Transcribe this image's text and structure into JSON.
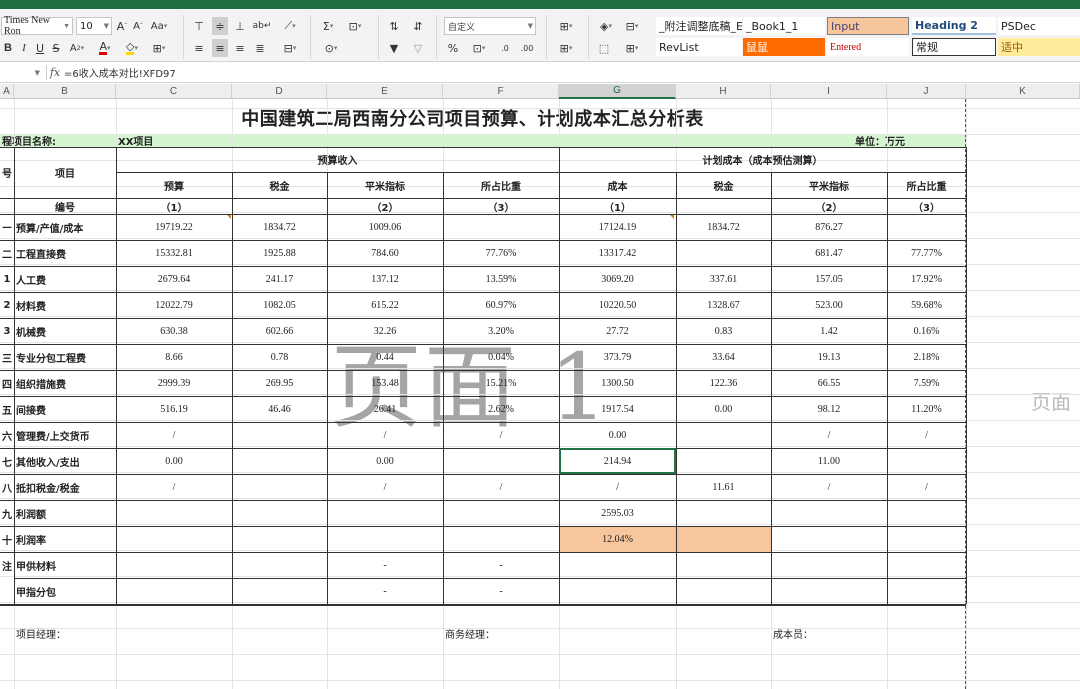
{
  "ribbon": {
    "font_name": "Times New Ron",
    "font_size": "10",
    "number_format": "自定义",
    "styles": [
      {
        "label": "_附注调整底稿_E",
        "bg": "#ffffff",
        "color": "#222222"
      },
      {
        "label": "_Book1_1",
        "bg": "#ffffff",
        "color": "#222222"
      },
      {
        "label": "Input",
        "bg": "#f6c59b",
        "color": "#3f3f76"
      },
      {
        "label": "Heading 2",
        "bg": "#ffffff",
        "color": "#1f497d"
      },
      {
        "label": "PSDec",
        "bg": "#ffffff",
        "color": "#222222"
      },
      {
        "label": "RevList",
        "bg": "#ffffff",
        "color": "#222222"
      },
      {
        "label": "鼠鼠",
        "bg": "#ff6a00",
        "color": "#ffffff"
      },
      {
        "label": "Entered",
        "bg": "#ffffff",
        "color": "#c00000"
      },
      {
        "label": "常规",
        "bg": "#ffffff",
        "color": "#222222"
      },
      {
        "label": "适中",
        "bg": "#ffeb9c",
        "color": "#9c5700"
      }
    ]
  },
  "formula_bar": {
    "fx": "fx",
    "formula": "=6收入成本对比!XFD97"
  },
  "columns": [
    "A",
    "B",
    "C",
    "D",
    "E",
    "F",
    "G",
    "H",
    "I",
    "J",
    "K"
  ],
  "sheet": {
    "title": "中国建筑二局西南分公司项目预算、计划成本汇总分析表",
    "project_label": "程项目名称:",
    "project_value": "XX项目",
    "unit_label": "单位：万元",
    "header_no": "号",
    "header_item": "项目",
    "header_budget": "预算收入",
    "header_plan": "计划成本（成本预估测算）",
    "sub_budget": [
      "预算",
      "税金",
      "平米指标",
      "所占比重"
    ],
    "sub_plan": [
      "成本",
      "税金",
      "平米指标",
      "所占比重"
    ],
    "code_label": "编号",
    "codes": [
      "（1）",
      "",
      "（2）",
      "（3）",
      "（1）",
      "",
      "（2）",
      "（3）"
    ],
    "rows": [
      {
        "no": "—",
        "item": "预算/产值/成本",
        "v": [
          "19719.22",
          "1834.72",
          "1009.06",
          "",
          "17124.19",
          "1834.72",
          "876.27",
          ""
        ]
      },
      {
        "no": "二",
        "item": "工程直接费",
        "v": [
          "15332.81",
          "1925.88",
          "784.60",
          "77.76%",
          "13317.42",
          "",
          "681.47",
          "77.77%"
        ]
      },
      {
        "no": "1",
        "item": "人工费",
        "v": [
          "2679.64",
          "241.17",
          "137.12",
          "13.59%",
          "3069.20",
          "337.61",
          "157.05",
          "17.92%"
        ]
      },
      {
        "no": "2",
        "item": "材料费",
        "v": [
          "12022.79",
          "1082.05",
          "615.22",
          "60.97%",
          "10220.50",
          "1328.67",
          "523.00",
          "59.68%"
        ]
      },
      {
        "no": "3",
        "item": "机械费",
        "v": [
          "630.38",
          "602.66",
          "32.26",
          "3.20%",
          "27.72",
          "0.83",
          "1.42",
          "0.16%"
        ]
      },
      {
        "no": "三",
        "item": "专业分包工程费",
        "v": [
          "8.66",
          "0.78",
          "0.44",
          "0.04%",
          "373.79",
          "33.64",
          "19.13",
          "2.18%"
        ]
      },
      {
        "no": "四",
        "item": "组织措施费",
        "v": [
          "2999.39",
          "269.95",
          "153.48",
          "15.21%",
          "1300.50",
          "122.36",
          "66.55",
          "7.59%"
        ]
      },
      {
        "no": "五",
        "item": "间接费",
        "v": [
          "516.19",
          "46.46",
          "26.41",
          "2.62%",
          "1917.54",
          "0.00",
          "98.12",
          "11.20%"
        ]
      },
      {
        "no": "六",
        "item": "管理费/上交货币",
        "v": [
          "/",
          "",
          "/",
          "/",
          "0.00",
          "",
          "/",
          "/"
        ]
      },
      {
        "no": "七",
        "item": "其他收入/支出",
        "v": [
          "0.00",
          "",
          "0.00",
          "",
          "214.94",
          "",
          "11.00",
          ""
        ]
      },
      {
        "no": "八",
        "item": "抵扣税金/税金",
        "v": [
          "/",
          "",
          "/",
          "/",
          "/",
          "11.61",
          "/",
          "/"
        ]
      },
      {
        "no": "九",
        "item": "利润额",
        "v": [
          "",
          "",
          "",
          "",
          "2595.03",
          "",
          "",
          ""
        ]
      },
      {
        "no": "十",
        "item": "利润率",
        "v": [
          "",
          "",
          "",
          "",
          "12.04%",
          "",
          "",
          ""
        ]
      },
      {
        "no": "注",
        "item": "甲供材料",
        "v": [
          "",
          "",
          "-",
          "-",
          "",
          "",
          "",
          ""
        ]
      },
      {
        "no": "",
        "item": "甲指分包",
        "v": [
          "",
          "",
          "-",
          "-",
          "",
          "",
          "",
          ""
        ]
      }
    ],
    "footer": [
      "项目经理：",
      "商务经理：",
      "成本员："
    ],
    "watermark": "页面 1",
    "watermark_right": "页面"
  },
  "colors": {
    "accent_green": "#217346",
    "title_bar_green": "#1f6e43",
    "project_row_green": "#d5f5d1",
    "profit_rate_fill": "#f8c69c"
  }
}
